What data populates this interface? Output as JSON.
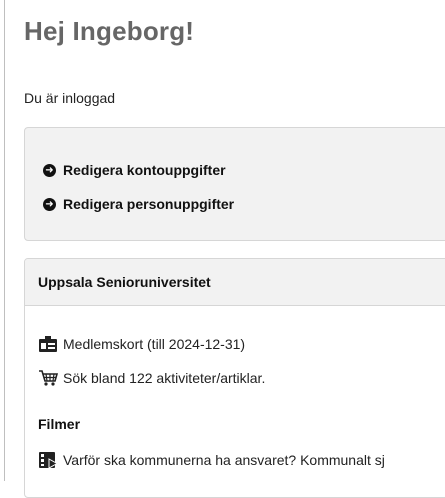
{
  "greeting": "Hej Ingeborg!",
  "status": "Du är inloggad",
  "links": [
    {
      "label": "Redigera kontouppgifter",
      "icon": "arrow-circle-right-icon"
    },
    {
      "label": "Redigera personuppgifter",
      "icon": "arrow-circle-right-icon"
    }
  ],
  "organization": {
    "title": "Uppsala Senioruniversitet",
    "membership": "Medlemskort (till 2024-12-31)",
    "search": "Sök bland 122 aktiviteter/artiklar.",
    "films_title": "Filmer",
    "film_item": "Varför ska kommunerna ha ansvaret? Kommunalt sj"
  }
}
